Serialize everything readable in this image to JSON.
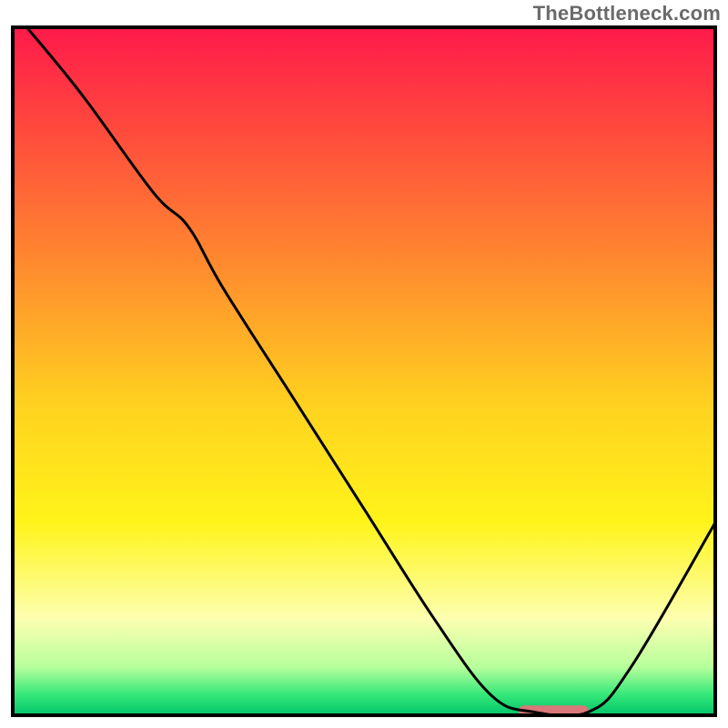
{
  "watermark": "TheBottleneck.com",
  "chart_data": {
    "type": "line",
    "title": "",
    "xlabel": "",
    "ylabel": "",
    "xlim": [
      0,
      100
    ],
    "ylim": [
      0,
      100
    ],
    "curve": [
      {
        "x": 2,
        "y": 100
      },
      {
        "x": 10,
        "y": 90
      },
      {
        "x": 20,
        "y": 76
      },
      {
        "x": 25,
        "y": 71
      },
      {
        "x": 30,
        "y": 62
      },
      {
        "x": 40,
        "y": 46
      },
      {
        "x": 50,
        "y": 30
      },
      {
        "x": 60,
        "y": 14
      },
      {
        "x": 68,
        "y": 3
      },
      {
        "x": 74,
        "y": 0.5
      },
      {
        "x": 82,
        "y": 0.5
      },
      {
        "x": 88,
        "y": 7
      },
      {
        "x": 100,
        "y": 28
      }
    ],
    "gradient_stops": [
      {
        "offset": 0.0,
        "color": "#ff1a4b"
      },
      {
        "offset": 0.15,
        "color": "#ff4a3d"
      },
      {
        "offset": 0.35,
        "color": "#ff8c2e"
      },
      {
        "offset": 0.55,
        "color": "#ffd21f"
      },
      {
        "offset": 0.72,
        "color": "#fff41a"
      },
      {
        "offset": 0.86,
        "color": "#fdffb0"
      },
      {
        "offset": 0.93,
        "color": "#b7ff9c"
      },
      {
        "offset": 0.97,
        "color": "#35e879"
      },
      {
        "offset": 1.0,
        "color": "#00c46a"
      }
    ],
    "marker": {
      "x_start": 72,
      "x_end": 82,
      "y": 0.5,
      "color": "#d9787a"
    },
    "frame_color": "#000000"
  }
}
